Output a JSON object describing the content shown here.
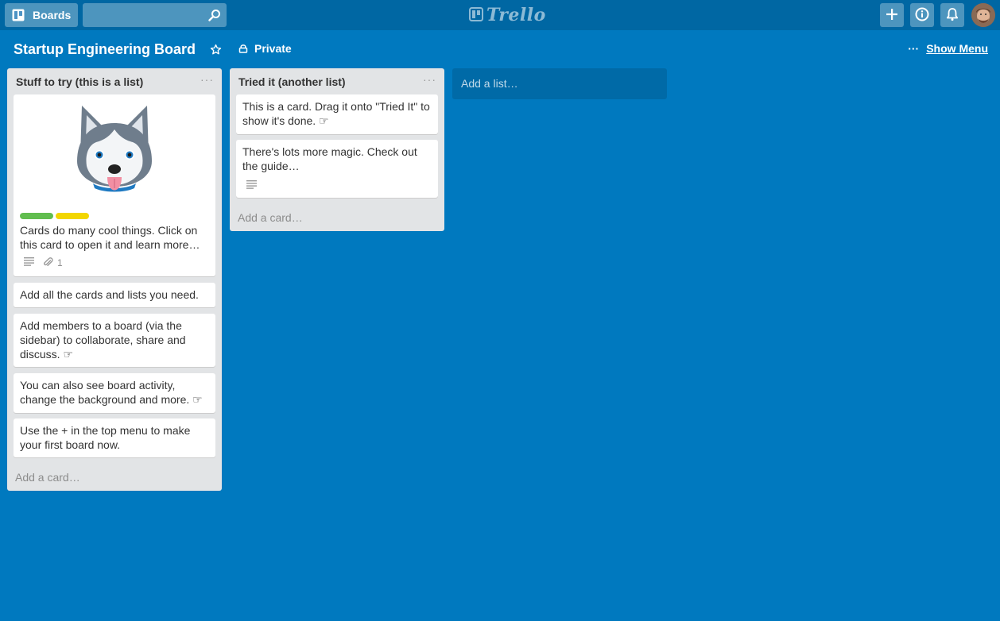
{
  "header": {
    "boards_label": "Boards",
    "search_value": "",
    "logo_text": "Trello"
  },
  "board": {
    "title": "Startup Engineering Board",
    "privacy": "Private",
    "show_menu": "Show Menu"
  },
  "lists": [
    {
      "title": "Stuff to try (this is a list)",
      "menu": "···",
      "cards": [
        {
          "text": "Cards do many cool things. Click on this card to open it and learn more…",
          "attachments": "1"
        },
        {
          "text": "Add all the cards and lists you need."
        },
        {
          "text": "Add members to a board (via the sidebar) to collaborate, share and discuss. ☞"
        },
        {
          "text": "You can also see board activity, change the background and more. ☞"
        },
        {
          "text": "Use the + in the top menu to make your first board now."
        }
      ],
      "add_card": "Add a card…"
    },
    {
      "title": "Tried it (another list)",
      "menu": "···",
      "cards": [
        {
          "text": "This is a card. Drag it onto \"Tried It\" to show it's done. ☞"
        },
        {
          "text": "There's lots more magic. Check out the guide…"
        }
      ],
      "add_card": "Add a card…"
    }
  ],
  "add_list": "Add a list…",
  "colors": {
    "board_bg": "#0079bf",
    "header_bg": "#0067a3",
    "list_bg": "#e2e4e6",
    "label_green": "#61bd4f",
    "label_yellow": "#f2d600"
  }
}
